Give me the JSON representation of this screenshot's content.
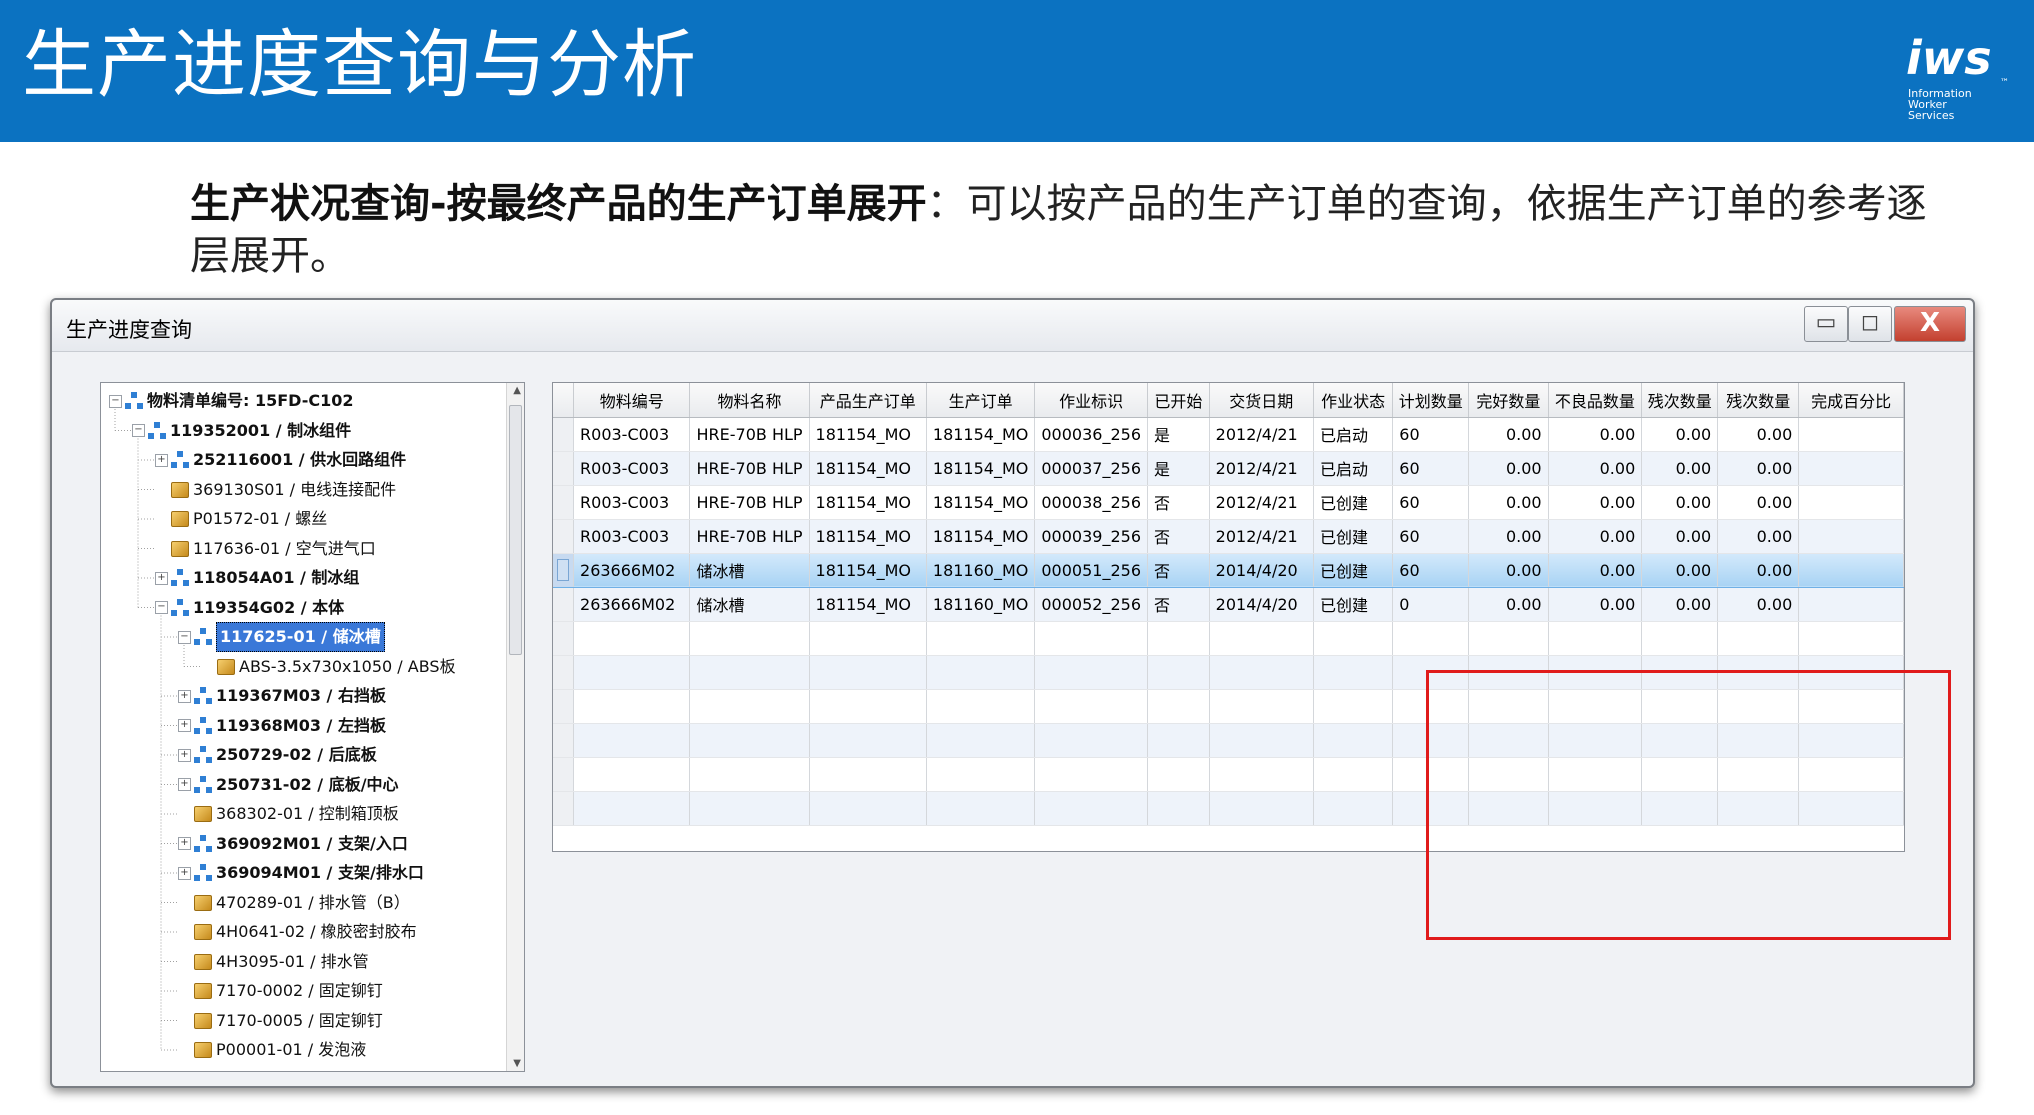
{
  "slide": {
    "title": "生产进度查询与分析",
    "logo": {
      "brand": "iws",
      "tm": "™",
      "subtitle_lines": [
        "Information",
        "Worker",
        "Services"
      ]
    },
    "description_bold": "生产状况查询-按最终产品的生产订单展开",
    "description_rest": "：可以按产品的生产订单的查询，依据生产订单的参考逐层展开。"
  },
  "window": {
    "title": "生产进度查询",
    "buttons": {
      "minimize": "▭",
      "maximize": "◻",
      "close": "X"
    }
  },
  "tree": {
    "nodes": [
      {
        "label": "物料清单编号: 15FD-C102",
        "level": 0,
        "icon": "bom-icon",
        "bold": true,
        "expander": "−"
      },
      {
        "label": "119352001 / 制冰组件",
        "level": 1,
        "icon": "hierarchy-icon",
        "bold": true,
        "expander": "−"
      },
      {
        "label": "252116001 / 供水回路组件",
        "level": 2,
        "icon": "hierarchy-icon",
        "bold": true,
        "expander": "+"
      },
      {
        "label": "369130S01 / 电线连接配件",
        "level": 2,
        "icon": "box-icon",
        "bold": false,
        "expander": ""
      },
      {
        "label": "P01572-01 / 螺丝",
        "level": 2,
        "icon": "box-icon",
        "bold": false,
        "expander": ""
      },
      {
        "label": "117636-01 / 空气进气口",
        "level": 2,
        "icon": "box-icon",
        "bold": false,
        "expander": ""
      },
      {
        "label": "118054A01 / 制冰组",
        "level": 2,
        "icon": "hierarchy-icon",
        "bold": true,
        "expander": "+"
      },
      {
        "label": "119354G02 / 本体",
        "level": 2,
        "icon": "hierarchy-icon",
        "bold": true,
        "expander": "−"
      },
      {
        "label": "117625-01 / 储冰槽",
        "level": 3,
        "icon": "hierarchy-icon",
        "bold": true,
        "expander": "−",
        "selected": true
      },
      {
        "label": "ABS-3.5x730x1050 / ABS板",
        "level": 4,
        "icon": "box-icon",
        "bold": false,
        "expander": ""
      },
      {
        "label": "119367M03 / 右挡板",
        "level": 3,
        "icon": "hierarchy-icon",
        "bold": true,
        "expander": "+"
      },
      {
        "label": "119368M03 / 左挡板",
        "level": 3,
        "icon": "hierarchy-icon",
        "bold": true,
        "expander": "+"
      },
      {
        "label": "250729-02 / 后底板",
        "level": 3,
        "icon": "hierarchy-icon",
        "bold": true,
        "expander": "+"
      },
      {
        "label": "250731-02 / 底板/中心",
        "level": 3,
        "icon": "hierarchy-icon",
        "bold": true,
        "expander": "+"
      },
      {
        "label": "368302-01 / 控制箱顶板",
        "level": 3,
        "icon": "box-icon",
        "bold": false,
        "expander": ""
      },
      {
        "label": "369092M01 / 支架/入口",
        "level": 3,
        "icon": "hierarchy-icon",
        "bold": true,
        "expander": "+"
      },
      {
        "label": "369094M01 / 支架/排水口",
        "level": 3,
        "icon": "hierarchy-icon",
        "bold": true,
        "expander": "+"
      },
      {
        "label": "470289-01 / 排水管（B）",
        "level": 3,
        "icon": "box-icon",
        "bold": false,
        "expander": ""
      },
      {
        "label": "4H0641-02 / 橡胶密封胶布",
        "level": 3,
        "icon": "box-icon",
        "bold": false,
        "expander": ""
      },
      {
        "label": "4H3095-01 / 排水管",
        "level": 3,
        "icon": "box-icon",
        "bold": false,
        "expander": ""
      },
      {
        "label": "7170-0002 / 固定铆钉",
        "level": 3,
        "icon": "box-icon",
        "bold": false,
        "expander": ""
      },
      {
        "label": "7170-0005 / 固定铆钉",
        "level": 3,
        "icon": "box-icon",
        "bold": false,
        "expander": ""
      },
      {
        "label": "P00001-01 / 发泡液",
        "level": 3,
        "icon": "box-icon",
        "bold": false,
        "expander": ""
      }
    ]
  },
  "grid": {
    "columns": [
      "物料编号",
      "物料名称",
      "产品生产订单",
      "生产订单",
      "作业标识",
      "已开始",
      "交货日期",
      "作业状态",
      "计划数量",
      "完好数量",
      "不良品数量",
      "残次数量",
      "残次数量",
      "完成百分比"
    ],
    "rows": [
      {
        "cells": [
          "R003-C003",
          "HRE-70B HLP",
          "181154_MO",
          "181154_MO",
          "000036_256",
          "是",
          "2012/4/21",
          "已启动",
          "60",
          "0.00",
          "0.00",
          "0.00",
          "0.00",
          ""
        ]
      },
      {
        "cells": [
          "R003-C003",
          "HRE-70B HLP",
          "181154_MO",
          "181154_MO",
          "000037_256",
          "是",
          "2012/4/21",
          "已启动",
          "60",
          "0.00",
          "0.00",
          "0.00",
          "0.00",
          ""
        ]
      },
      {
        "cells": [
          "R003-C003",
          "HRE-70B HLP",
          "181154_MO",
          "181154_MO",
          "000038_256",
          "否",
          "2012/4/21",
          "已创建",
          "60",
          "0.00",
          "0.00",
          "0.00",
          "0.00",
          ""
        ]
      },
      {
        "cells": [
          "R003-C003",
          "HRE-70B HLP",
          "181154_MO",
          "181154_MO",
          "000039_256",
          "否",
          "2012/4/21",
          "已创建",
          "60",
          "0.00",
          "0.00",
          "0.00",
          "0.00",
          ""
        ]
      },
      {
        "cells": [
          "263666M02",
          "储冰槽",
          "181154_MO",
          "181160_MO",
          "000051_256",
          "否",
          "2014/4/20",
          "已创建",
          "60",
          "0.00",
          "0.00",
          "0.00",
          "0.00",
          ""
        ],
        "selected": true
      },
      {
        "cells": [
          "263666M02",
          "储冰槽",
          "181154_MO",
          "181160_MO",
          "000052_256",
          "否",
          "2014/4/20",
          "已创建",
          "0",
          "0.00",
          "0.00",
          "0.00",
          "0.00",
          ""
        ]
      }
    ],
    "empty_rows": 6
  },
  "colors": {
    "banner": "#0b72c1",
    "highlight": "#e01b1b",
    "selection": "#a8d3f4"
  }
}
